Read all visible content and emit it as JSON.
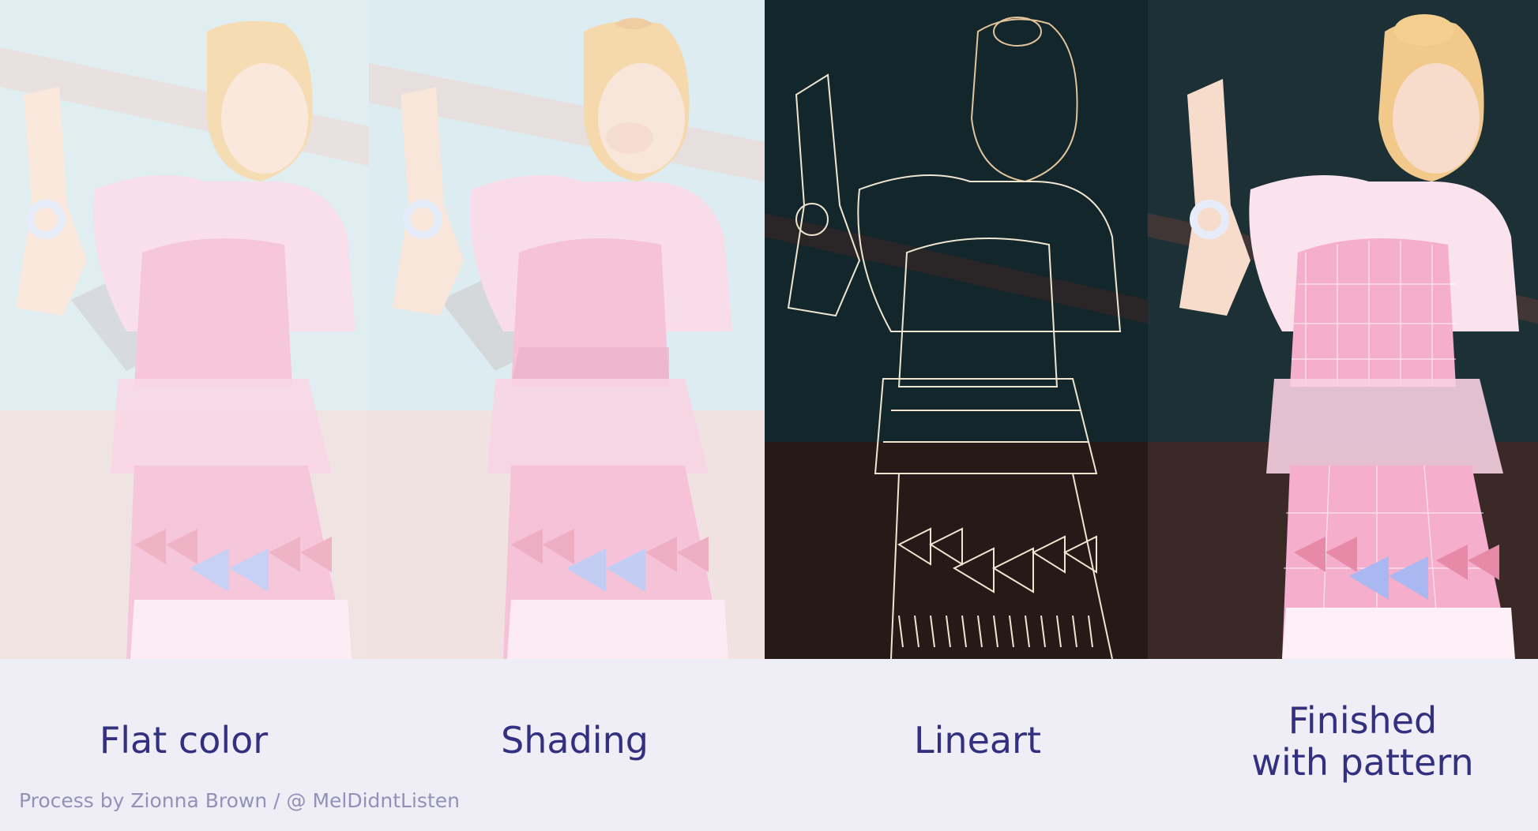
{
  "panels": [
    {
      "caption": "Flat color"
    },
    {
      "caption": "Shading"
    },
    {
      "caption": "Lineart"
    },
    {
      "caption_line1": "Finished",
      "caption_line2": "with pattern"
    }
  ],
  "credit": "Process by Zionna Brown / @ MelDidntListen",
  "colors": {
    "footer_bg": "#efeef7",
    "caption_text": "#33307f",
    "credit_text": "#9391b8",
    "dress_pink": "#f2a8c8",
    "hair_blonde": "#f1c98a",
    "bow_blue": "#a9b8f0",
    "lineart_bg": "#13262b"
  }
}
